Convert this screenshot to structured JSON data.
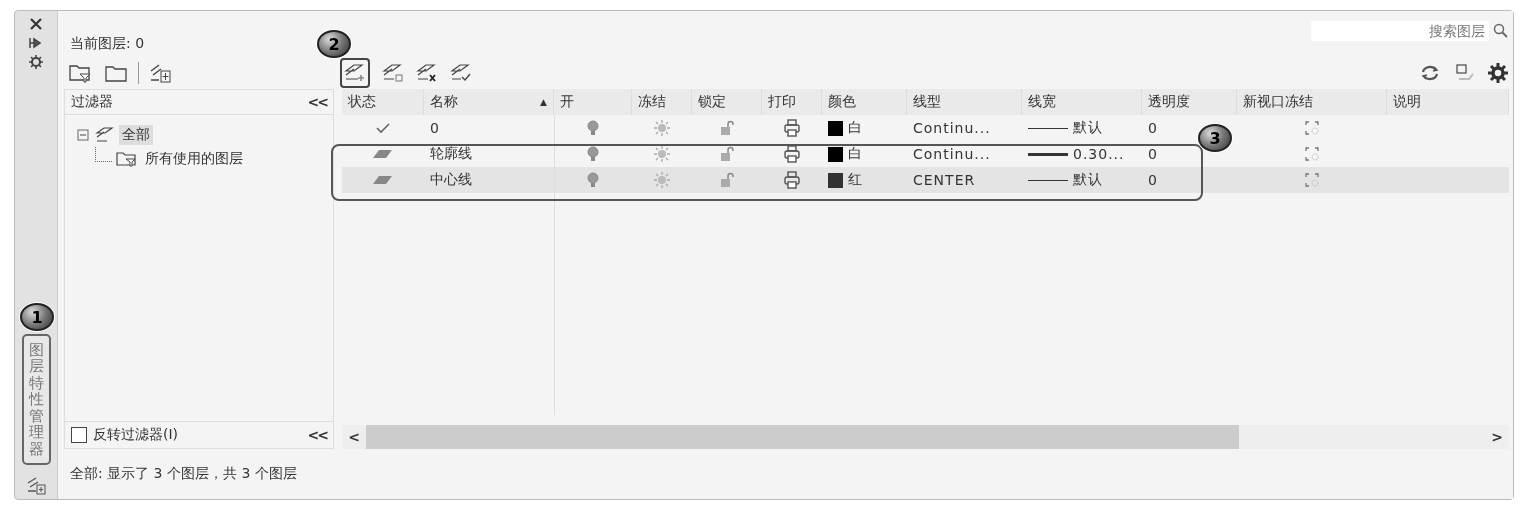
{
  "side_strip": {
    "title": "图层特性管理器"
  },
  "current_layer": "当前图层: 0",
  "search": {
    "placeholder": "搜索图层"
  },
  "filters": {
    "header": "过滤器",
    "collapse": "<<",
    "tree": [
      {
        "label": "全部",
        "selected": true,
        "expanded": true,
        "children": [
          {
            "label": "所有使用的图层",
            "selected": false
          }
        ]
      }
    ],
    "invert": {
      "label": "反转过滤器(I)",
      "checked": false
    },
    "collapse_bottom": "<<"
  },
  "table": {
    "columns": [
      {
        "label": "状态"
      },
      {
        "label": "名称",
        "sort_mark": "▲"
      },
      {
        "label": "开"
      },
      {
        "label": "冻结"
      },
      {
        "label": "锁定"
      },
      {
        "label": "打印"
      },
      {
        "label": "颜色"
      },
      {
        "label": "线型"
      },
      {
        "label": "线宽"
      },
      {
        "label": "透明度"
      },
      {
        "label": "新视口冻结"
      },
      {
        "label": "说明"
      }
    ],
    "rows": [
      {
        "kind": "current",
        "name": "0",
        "on": true,
        "frozen": false,
        "locked": false,
        "plot": true,
        "color": "#000000",
        "color_name": "白",
        "linetype": "Continu...",
        "line_heavy": false,
        "lineweight": "默认",
        "transparency": "0",
        "selected": false
      },
      {
        "kind": "layer",
        "name": "轮廓线",
        "on": true,
        "frozen": false,
        "locked": false,
        "plot": true,
        "color": "#000000",
        "color_name": "白",
        "linetype": "Continu...",
        "line_heavy": true,
        "lineweight": "0.30...",
        "transparency": "0",
        "selected": false
      },
      {
        "kind": "layer",
        "name": "中心线",
        "on": true,
        "frozen": false,
        "locked": false,
        "plot": true,
        "color": "#333333",
        "color_name": "红",
        "linetype": "CENTER",
        "line_heavy": false,
        "lineweight": "默认",
        "transparency": "0",
        "selected": true
      }
    ]
  },
  "scrollbar": {
    "left": "<",
    "right": ">"
  },
  "status_bar": "全部: 显示了 3 个图层，共 3 个图层",
  "callouts": [
    {
      "number": "1"
    },
    {
      "number": "2"
    },
    {
      "number": "3"
    }
  ]
}
